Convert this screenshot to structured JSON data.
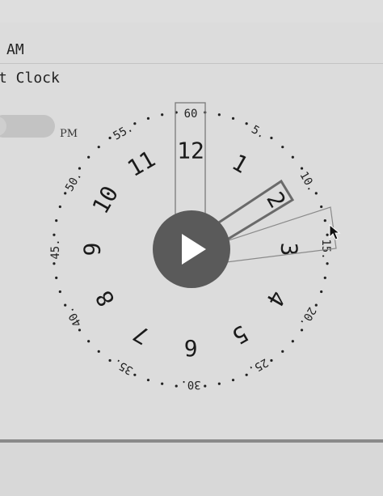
{
  "header": {
    "time_text": "AM",
    "title": "t Clock"
  },
  "toggle": {
    "pm_label": "PM"
  },
  "dial": {
    "hours": [
      "12",
      "1",
      "2",
      "3",
      "4",
      "5",
      "6",
      "7",
      "8",
      "9",
      "10",
      "11"
    ],
    "minutes": [
      "60",
      "5",
      "10",
      "15",
      "20",
      "25",
      "30",
      "35",
      "40",
      "45",
      "50",
      "55"
    ]
  },
  "controls": {
    "play_icon": "play-icon",
    "cursor_icon": "mouse-pointer-icon"
  }
}
